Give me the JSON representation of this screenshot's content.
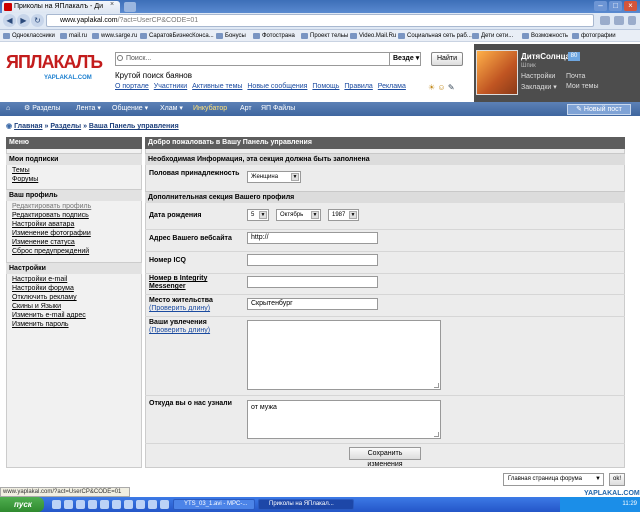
{
  "browser": {
    "tab_title": "Приколы на ЯПлакалъ - Ди",
    "tab_close": "×",
    "url_host": "www.yaplakal.com",
    "url_path": "/?act=UserCP&CODE=01",
    "win_minimize": "–",
    "win_maximize": "□",
    "win_close": "×",
    "bookmarks": [
      "Одноклассники",
      "mail.ru",
      "www.sarge.ru",
      "СаратовБизнесКонса...",
      "Бонусы",
      "Фотострана",
      "Проект тельы",
      "Video.Mail.Ru",
      "Социальная сеть раб...",
      "Дети сети...",
      "Возможность",
      "фотографии"
    ]
  },
  "header": {
    "logo_text": "ЯПЛАКАЛЪ",
    "logo_sub": "YAPLAKAL.COM",
    "search_placeholder": "Поиск...",
    "search_scope": "Везде",
    "search_button": "Найти",
    "tagline": "Крутой поиск баянов",
    "links": [
      "О портале",
      "Участники",
      "Активные темы",
      "Новые сообщения",
      "Помощь",
      "Правила",
      "Реклама"
    ]
  },
  "user": {
    "name": "ДитяСолнца",
    "badge": "80",
    "status": "Шпик",
    "settings": "Настройки",
    "bookmarks": "Закладки",
    "mail": "Почта",
    "my_topics": "Мои темы"
  },
  "menu": {
    "items": [
      "Разделы",
      "Лента",
      "Общение",
      "Хлам",
      "Инкубатор",
      "Арт",
      "ЯП Файлы"
    ],
    "new_post": "Новый пост"
  },
  "breadcrumb": [
    "Главная",
    "Разделы",
    "Ваша Панель управления"
  ],
  "sidebar": {
    "menu_title": "Меню",
    "subs_title": "Мои подписки",
    "subs": [
      "Темы",
      "Форумы"
    ],
    "profile_title": "Ваш профиль",
    "profile": [
      "Редактировать профиль",
      "Редактировать подпись",
      "Настройки аватара",
      "Изменение фотографии",
      "Изменение статуса",
      "Сброс предупреждений"
    ],
    "settings_title": "Настройки",
    "settings": [
      "Настройки e-mail",
      "Настройки форума",
      "Отключить рекламу",
      "Скины и Языки",
      "Изменить e-mail адрес",
      "Изменить пароль"
    ]
  },
  "form": {
    "title": "Добро пожаловать в Вашу Панель управления",
    "required_section": "Необходимая Информация, эта секция должна быть заполнена",
    "gender_label": "Половая принадлежность",
    "gender_value": "Женщина",
    "optional_section": "Дополнительная секция Вашего профиля",
    "birthday_label": "Дата рождения",
    "birth_day": "5",
    "birth_month": "Октябрь",
    "birth_year": "1987",
    "website_label": "Адрес Вашего вебсайта",
    "website_value": "http://",
    "icq_label": "Номер ICQ",
    "icq_value": "",
    "integrity_label": "Номер в Integrity Messenger",
    "integrity_value": "",
    "location_label": "Место жительства",
    "check_length": "(Проверить длину)",
    "location_value": "Скрытенбург",
    "interests_label": "Ваши увлечения",
    "interests_value": "",
    "source_label": "Откуда вы о нас узнали",
    "source_value": "от мужа",
    "save_button": "Сохранить изменения"
  },
  "footer": {
    "jump_value": "Главная страница форума",
    "jump_go": "ok!",
    "status_url": "www.yaplakal.com/?act=UserCP&CODE=01",
    "watermark": "YAPLAKAL.COM"
  },
  "taskbar": {
    "start": "пуск",
    "tasks": [
      "YTS_03_1.avi - MPC-...",
      "Приколы на ЯПлакал..."
    ],
    "clock": "11:29"
  }
}
